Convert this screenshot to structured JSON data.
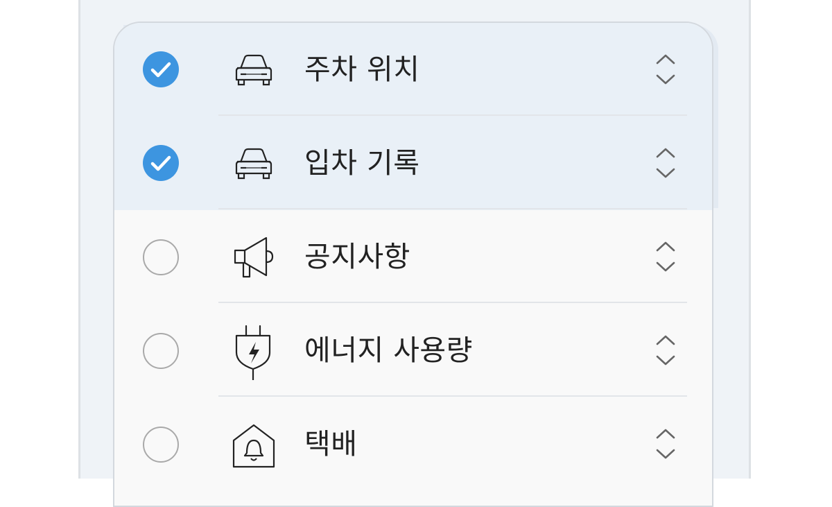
{
  "colors": {
    "accent": "#3d95e0",
    "checked_row_bg": "#e9f0f7",
    "card_bg": "#f9f9f9",
    "text": "#222222"
  },
  "list": {
    "items": [
      {
        "label": "주차 위치",
        "checked": true,
        "icon": "car-icon"
      },
      {
        "label": "입차 기록",
        "checked": true,
        "icon": "car-icon"
      },
      {
        "label": "공지사항",
        "checked": false,
        "icon": "megaphone-icon"
      },
      {
        "label": "에너지 사용량",
        "checked": false,
        "icon": "plug-energy-icon"
      },
      {
        "label": "택배",
        "checked": false,
        "icon": "house-bell-icon"
      }
    ]
  }
}
